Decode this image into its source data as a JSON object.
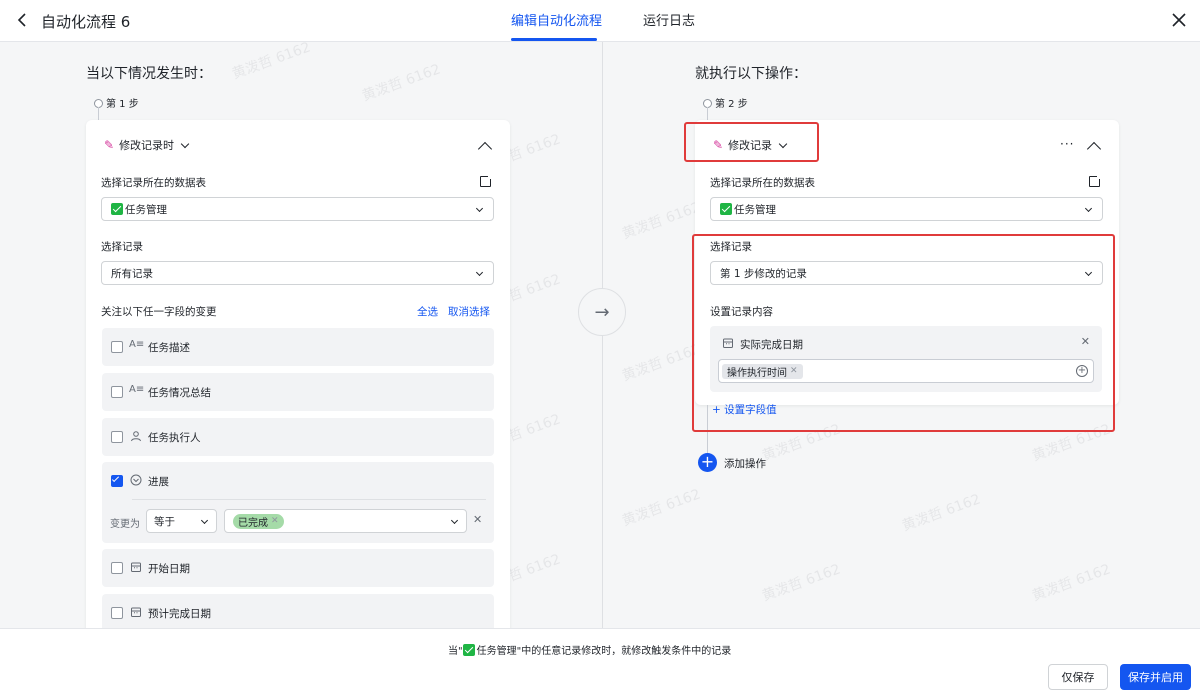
{
  "header": {
    "title": "自动化流程 6",
    "tabs": [
      {
        "label": "编辑自动化流程",
        "active": true
      },
      {
        "label": "运行日志",
        "active": false
      }
    ]
  },
  "trigger": {
    "section_title": "当以下情况发生时：",
    "step_label": "第 1 步",
    "type_label": "修改记录时",
    "table_label": "选择记录所在的数据表",
    "table_value": "任务管理",
    "record_label": "选择记录",
    "record_value": "所有记录",
    "watch_label": "关注以下任一字段的变更",
    "select_all": "全选",
    "deselect": "取消选择",
    "fields": [
      {
        "icon": "A≡",
        "name": "任务描述",
        "checked": false
      },
      {
        "icon": "A≡",
        "name": "任务情况总结",
        "checked": false
      },
      {
        "icon": "person",
        "name": "任务执行人",
        "checked": false
      },
      {
        "icon": "progress",
        "name": "进展",
        "checked": true
      },
      {
        "icon": "calendar",
        "name": "开始日期",
        "checked": false
      },
      {
        "icon": "calendar",
        "name": "预计完成日期",
        "checked": false
      }
    ],
    "condition": {
      "prefix": "变更为",
      "operator": "等于",
      "value_tag": "已完成"
    }
  },
  "action": {
    "section_title": "就执行以下操作：",
    "step_label": "第 2 步",
    "type_label": "修改记录",
    "table_label": "选择记录所在的数据表",
    "table_value": "任务管理",
    "record_label": "选择记录",
    "record_value": "第 1 步修改的记录",
    "content_label": "设置记录内容",
    "set_field_name": "实际完成日期",
    "set_field_value_tag": "操作执行时间",
    "add_field_link": "+ 设置字段值",
    "add_action_label": "添加操作",
    "more": "···"
  },
  "footer": {
    "message_prefix": "当\"",
    "message_table": "任务管理",
    "message_suffix": "\"中的任意记录修改时，就修改触发条件中的记录",
    "save_only": "仅保存",
    "save_enable": "保存并启用"
  },
  "watermark_text": "黄泼哲 6162",
  "colors": {
    "accent": "#1456f0",
    "highlight_border": "#e03b3b",
    "status_done_tag": "#a5dba8",
    "table_icon_green": "#1fb544",
    "trigger_icon_pink": "#d4379a"
  }
}
